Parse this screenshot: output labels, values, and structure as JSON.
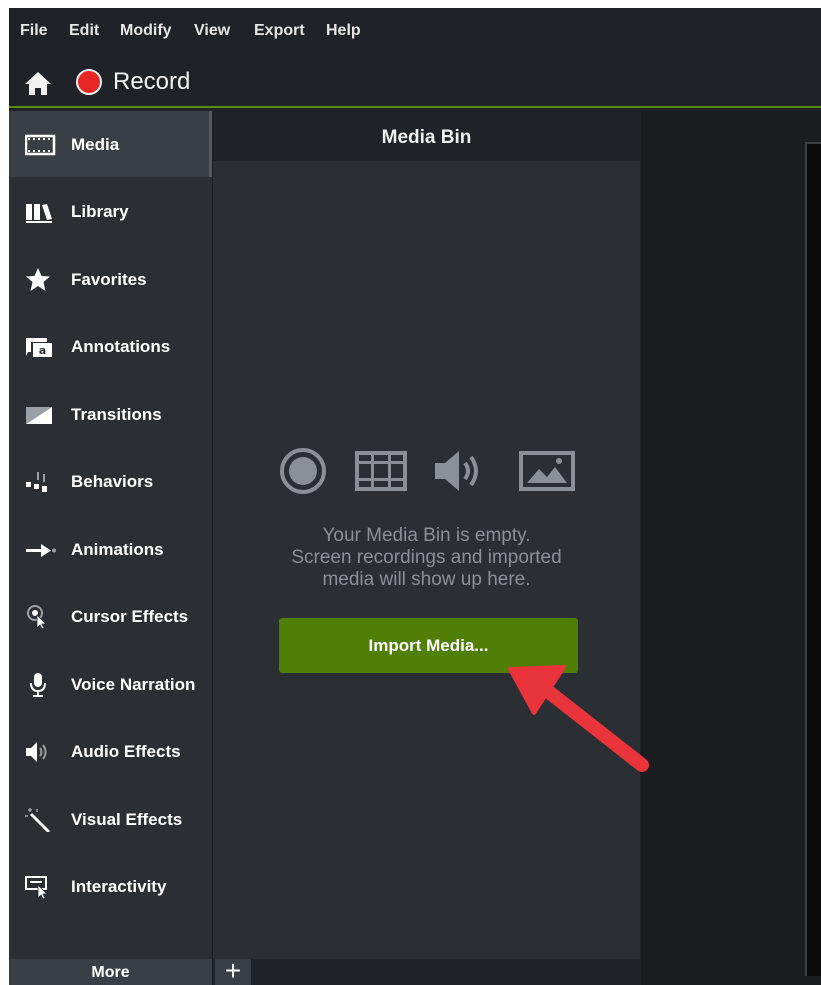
{
  "menubar": {
    "items": [
      "File",
      "Edit",
      "Modify",
      "View",
      "Export",
      "Help"
    ]
  },
  "recordbar": {
    "record_label": "Record"
  },
  "sidebar": {
    "items": [
      {
        "label": "Media",
        "icon": "filmstrip-icon",
        "active": true
      },
      {
        "label": "Library",
        "icon": "library-icon"
      },
      {
        "label": "Favorites",
        "icon": "star-icon"
      },
      {
        "label": "Annotations",
        "icon": "annotation-icon"
      },
      {
        "label": "Transitions",
        "icon": "transition-icon"
      },
      {
        "label": "Behaviors",
        "icon": "behaviors-icon"
      },
      {
        "label": "Animations",
        "icon": "animation-arrow-icon"
      },
      {
        "label": "Cursor Effects",
        "icon": "cursor-effects-icon"
      },
      {
        "label": "Voice Narration",
        "icon": "microphone-icon"
      },
      {
        "label": "Audio Effects",
        "icon": "speaker-icon"
      },
      {
        "label": "Visual Effects",
        "icon": "magic-wand-icon"
      },
      {
        "label": "Interactivity",
        "icon": "interactivity-icon"
      }
    ],
    "more_label": "More"
  },
  "media_bin": {
    "title": "Media Bin",
    "empty_line1": "Your Media Bin is empty.",
    "empty_line2": "Screen recordings and imported",
    "empty_line3": "media will show up here.",
    "import_label": "Import Media...",
    "add_label": "+"
  },
  "colors": {
    "accent_green": "#4f7f07",
    "record_red": "#e82626",
    "arrow_red": "#e8343a"
  }
}
